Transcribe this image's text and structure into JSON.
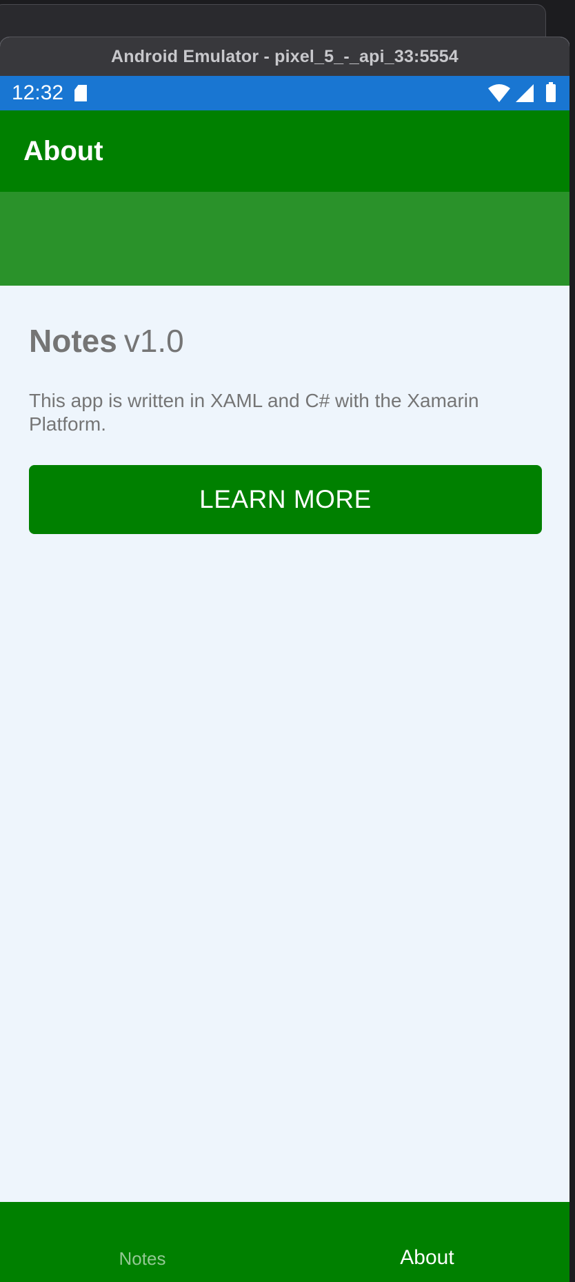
{
  "window": {
    "title": "Android Emulator - pixel_5_-_api_33:5554"
  },
  "status_bar": {
    "time": "12:32",
    "icons": [
      "sd-card-icon",
      "wifi-icon",
      "cellular-signal-icon",
      "battery-icon"
    ]
  },
  "app_bar": {
    "title": "About"
  },
  "about": {
    "app_name": "Notes",
    "version": "v1.0",
    "description": "This app is written in XAML and C# with the Xamarin Platform.",
    "learn_more_label": "LEARN MORE"
  },
  "tabs": [
    {
      "label": "Notes",
      "selected": false
    },
    {
      "label": "About",
      "selected": true
    }
  ],
  "colors": {
    "status_bar": "#1976d2",
    "primary": "#008000",
    "hero": "#2a922a",
    "page_background": "#eef5fc",
    "body_text": "#757575"
  }
}
